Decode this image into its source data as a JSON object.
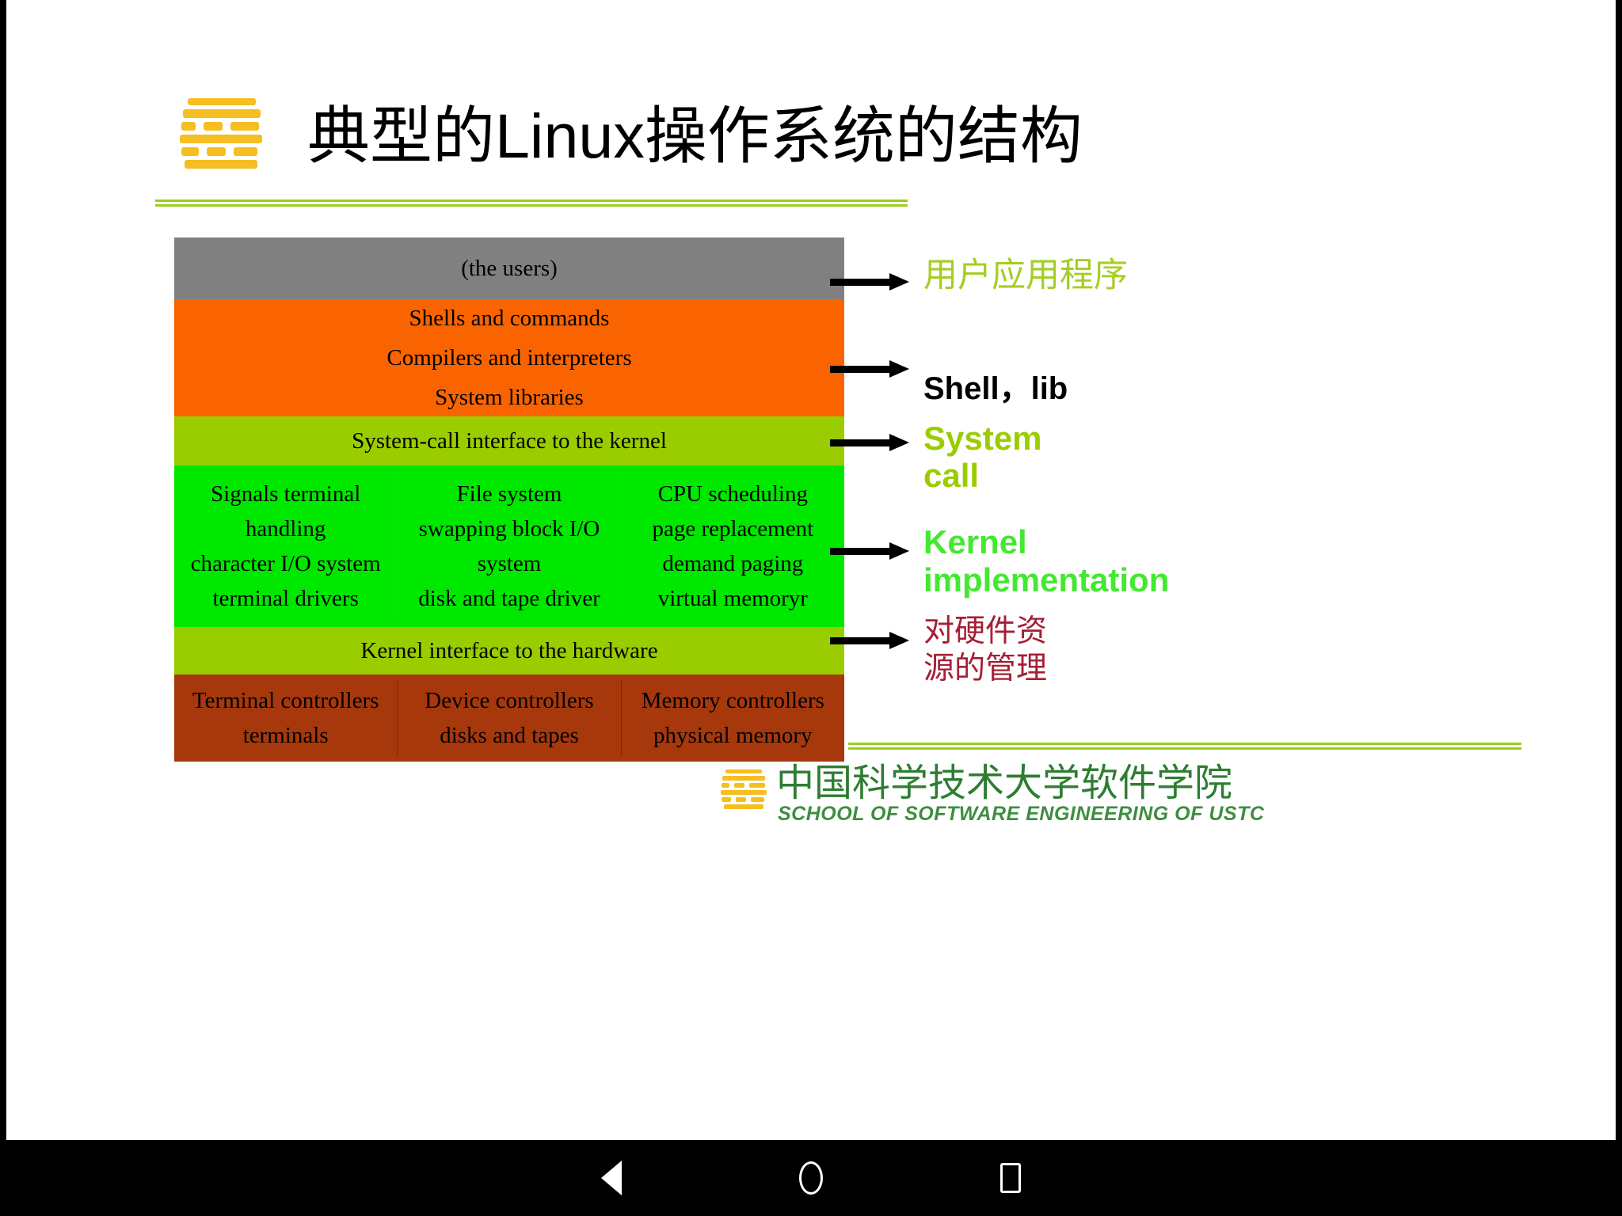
{
  "slide": {
    "title": "典型的Linux操作系统的结构",
    "logo_icon": "ustc-sse-striped-logo"
  },
  "diagram": {
    "layers": [
      {
        "id": "users",
        "color": "#808080",
        "lines": [
          "(the users)"
        ]
      },
      {
        "id": "shells",
        "color": "#FA6400",
        "lines": [
          "Shells and commands",
          "Compilers and interpreters",
          "System libraries"
        ]
      },
      {
        "id": "syscall",
        "color": "#9ACD00",
        "lines": [
          "System-call interface to the kernel"
        ]
      },
      {
        "id": "kernel",
        "color": "#00E800",
        "columns": [
          [
            "Signals terminal",
            "handling",
            "character I/O system",
            "terminal    drivers"
          ],
          [
            "File system",
            "swapping block I/O",
            "system",
            "disk and tape driver"
          ],
          [
            "CPU scheduling",
            "page replacement",
            "demand paging",
            "virtual memoryr"
          ]
        ]
      },
      {
        "id": "hardware-interface",
        "color": "#9ACD00",
        "lines": [
          "Kernel interface to the hardware"
        ]
      },
      {
        "id": "hardware",
        "color": "#A6380C",
        "columns": [
          [
            "Terminal controllers",
            "terminals"
          ],
          [
            "Device controllers",
            "disks and tapes"
          ],
          [
            "Memory controllers",
            "physical memory"
          ]
        ]
      }
    ]
  },
  "annotations": [
    {
      "id": "users",
      "text": "用户应用程序",
      "color": "#A4CE21"
    },
    {
      "id": "shell",
      "text": "Shell，lib",
      "color": "#000000"
    },
    {
      "id": "syscall",
      "text": "System\ncall",
      "color": "#9ACD00"
    },
    {
      "id": "kernel",
      "text": "Kernel\nimplementation",
      "color": "#44E831"
    },
    {
      "id": "hardware",
      "text": "对硬件资\n源的管理",
      "color": "#A41F35"
    }
  ],
  "footer": {
    "logo_icon": "ustc-sse-striped-logo",
    "cn_name": "中国科学技术大学软件学院",
    "en_name": "SCHOOL OF SOFTWARE ENGINEERING OF USTC",
    "color": "#2E7D32"
  },
  "navbar": {
    "back_icon": "triangle-back-icon",
    "home_icon": "circle-home-icon",
    "recents_icon": "square-recents-icon"
  }
}
